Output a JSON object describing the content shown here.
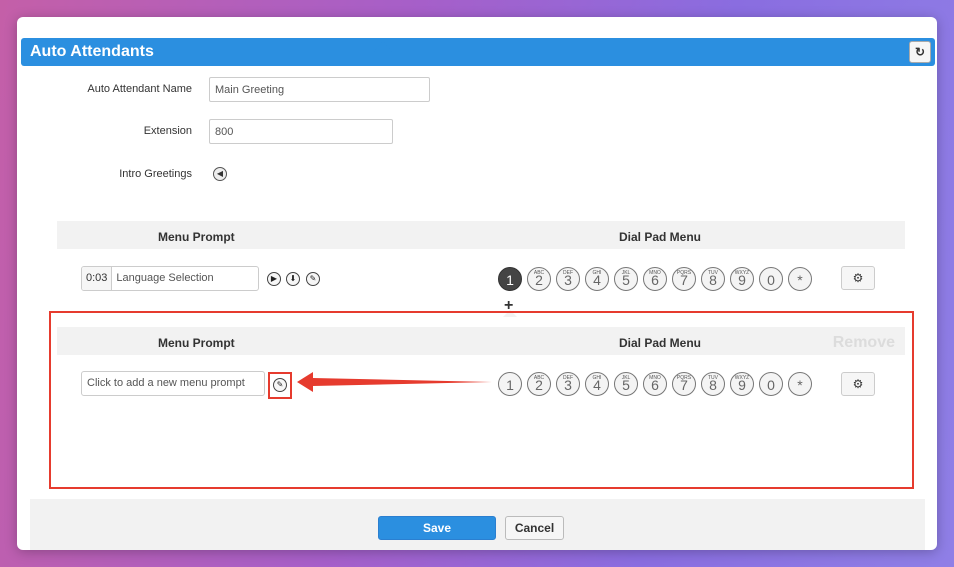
{
  "window": {
    "title": "Auto Attendants",
    "refresh_icon": "↻"
  },
  "form": {
    "name_label": "Auto Attendant Name",
    "name_value": "Main Greeting",
    "extension_label": "Extension",
    "extension_value": "800",
    "intro_label": "Intro Greetings",
    "speaker_icon": "◀"
  },
  "menu1": {
    "header_prompt": "Menu Prompt",
    "header_dialpad": "Dial Pad Menu",
    "duration": "0:03",
    "prompt_text": "Language Selection",
    "play_icon": "▶",
    "download_icon": "⬇",
    "edit_icon": "✎",
    "gear_icon": "⚙",
    "active_key": "1"
  },
  "add_icon": "+",
  "menu2": {
    "header_prompt": "Menu Prompt",
    "header_dialpad": "Dial Pad Menu",
    "remove_label": "Remove",
    "prompt_placeholder": "Click to add a new menu prompt",
    "edit_icon": "✎",
    "gear_icon": "⚙"
  },
  "dialpad_keys": [
    {
      "num": "1",
      "letters": ""
    },
    {
      "num": "2",
      "letters": "ABC"
    },
    {
      "num": "3",
      "letters": "DEF"
    },
    {
      "num": "4",
      "letters": "GHI"
    },
    {
      "num": "5",
      "letters": "JKL"
    },
    {
      "num": "6",
      "letters": "MNO"
    },
    {
      "num": "7",
      "letters": "PQRS"
    },
    {
      "num": "8",
      "letters": "TUV"
    },
    {
      "num": "9",
      "letters": "WXYZ"
    },
    {
      "num": "0",
      "letters": ""
    },
    {
      "num": "*",
      "letters": ""
    }
  ],
  "footer": {
    "save_label": "Save",
    "cancel_label": "Cancel"
  },
  "colors": {
    "brand_blue": "#2b8fe0",
    "annotation_red": "#e63b2e"
  }
}
